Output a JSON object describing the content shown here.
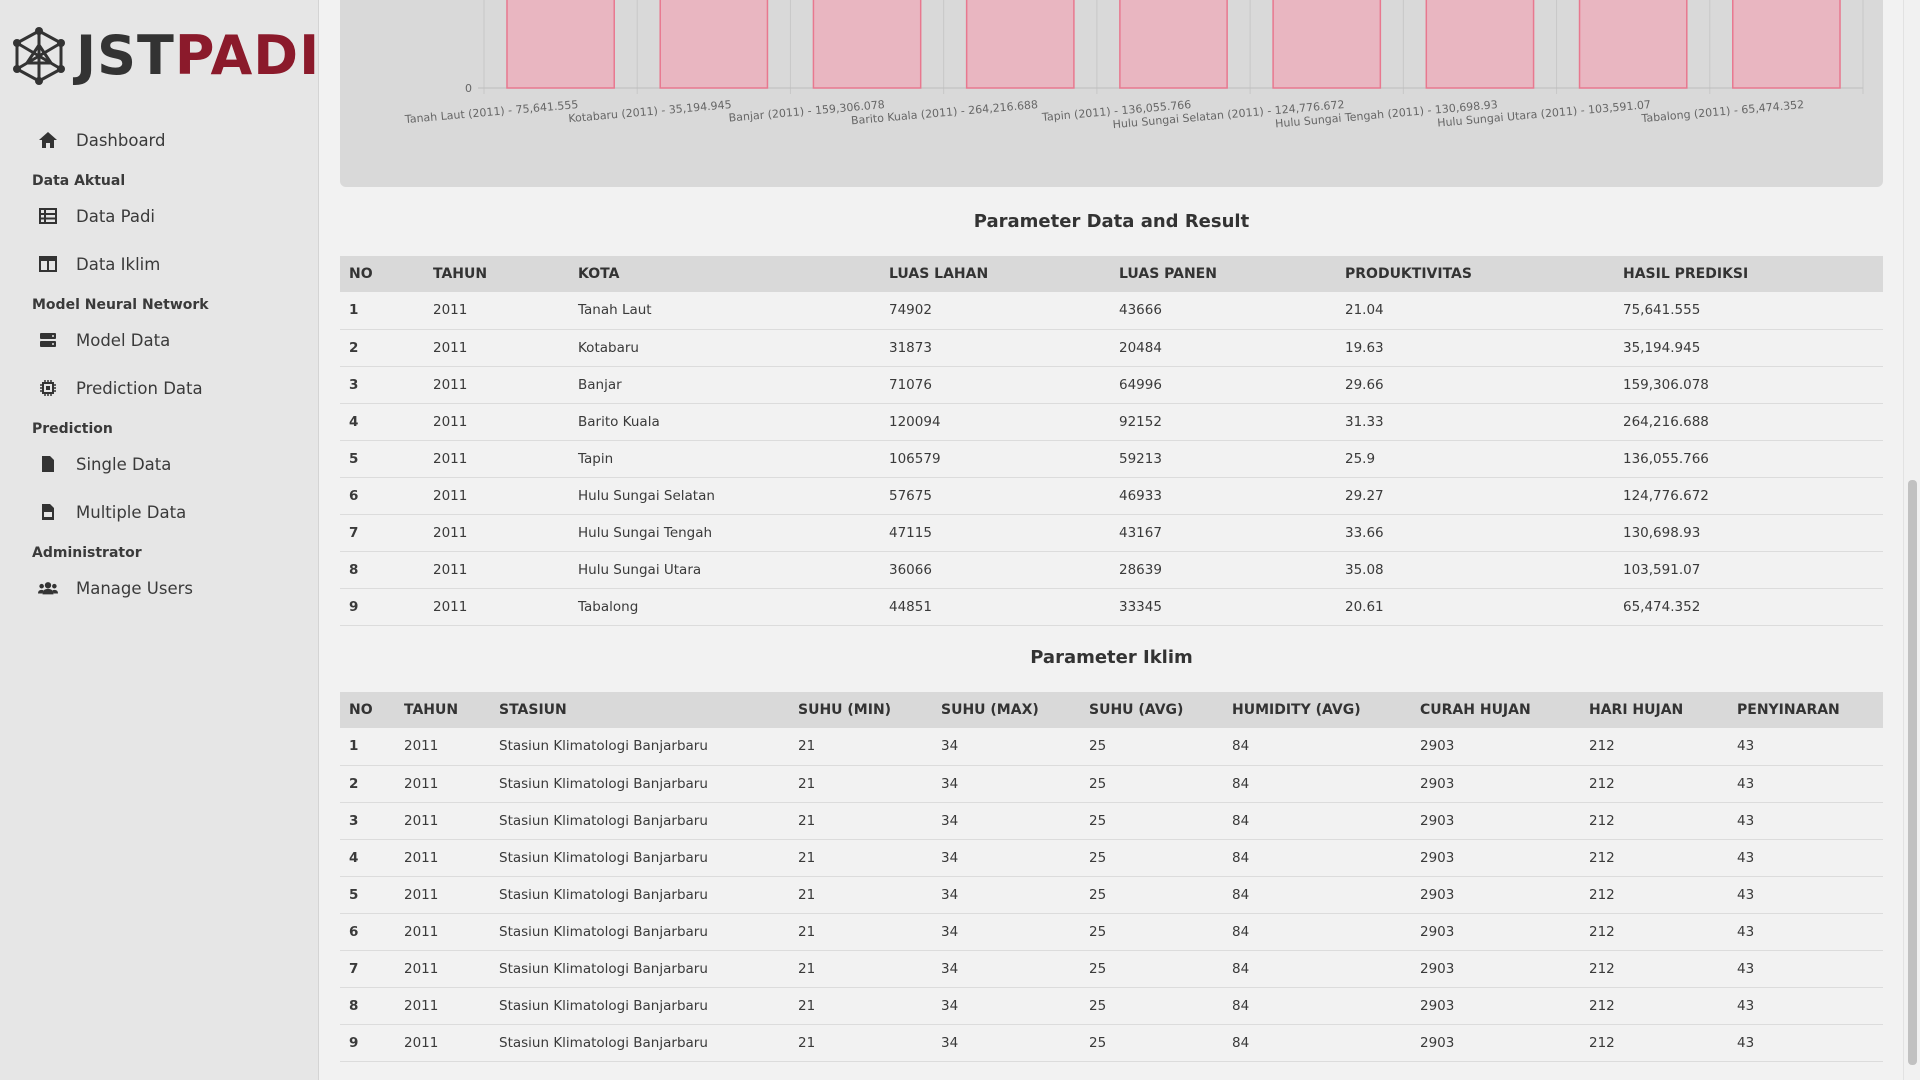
{
  "brand": {
    "part1": "JST",
    "part2": "PADI",
    "accent": "#8b1a2b"
  },
  "sidebar": {
    "dashboard": "Dashboard",
    "sections": {
      "data_aktual": "Data Aktual",
      "model_nn": "Model Neural Network",
      "prediction": "Prediction",
      "administrator": "Administrator"
    },
    "items": {
      "data_padi": "Data Padi",
      "data_iklim": "Data Iklim",
      "model_data": "Model Data",
      "prediction_data": "Prediction Data",
      "single_data": "Single Data",
      "multiple_data": "Multiple Data",
      "manage_users": "Manage Users"
    },
    "icons": {
      "dashboard": "home-icon",
      "data_padi": "table-list-icon",
      "data_iklim": "columns-icon",
      "model_data": "server-icon",
      "prediction_data": "microchip-icon",
      "single_data": "file-icon",
      "multiple_data": "file-csv-icon",
      "manage_users": "users-icon"
    }
  },
  "chart_data": {
    "type": "bar",
    "categories": [
      "Tanah Laut (2011) - 75,641.555",
      "Kotabaru (2011) - 35,194.945",
      "Banjar (2011) - 159,306.078",
      "Barito Kuala (2011) - 264,216.688",
      "Tapin (2011) - 136,055.766",
      "Hulu Sungai Selatan (2011) - 124,776.672",
      "Hulu Sungai Tengah (2011) - 130,698.93",
      "Hulu Sungai Utara (2011) - 103,591.07",
      "Tabalong (2011) - 65,474.352"
    ],
    "values": [
      75641.555,
      35194.945,
      159306.078,
      264216.688,
      136055.766,
      124776.672,
      130698.93,
      103591.07,
      65474.352
    ],
    "y_ticks_visible": [
      "0"
    ],
    "ylim_visible": [
      0,
      30000
    ],
    "bar_fill": "#e9b6c1",
    "bar_stroke": "#e8788f",
    "grid": true
  },
  "result_section": {
    "title": "Parameter Data and Result",
    "headers": [
      "NO",
      "TAHUN",
      "KOTA",
      "LUAS LAHAN",
      "LUAS PANEN",
      "PRODUKTIVITAS",
      "HASIL PREDIKSI"
    ],
    "rows": [
      [
        "1",
        "2011",
        "Tanah Laut",
        "74902",
        "43666",
        "21.04",
        "75,641.555"
      ],
      [
        "2",
        "2011",
        "Kotabaru",
        "31873",
        "20484",
        "19.63",
        "35,194.945"
      ],
      [
        "3",
        "2011",
        "Banjar",
        "71076",
        "64996",
        "29.66",
        "159,306.078"
      ],
      [
        "4",
        "2011",
        "Barito Kuala",
        "120094",
        "92152",
        "31.33",
        "264,216.688"
      ],
      [
        "5",
        "2011",
        "Tapin",
        "106579",
        "59213",
        "25.9",
        "136,055.766"
      ],
      [
        "6",
        "2011",
        "Hulu Sungai Selatan",
        "57675",
        "46933",
        "29.27",
        "124,776.672"
      ],
      [
        "7",
        "2011",
        "Hulu Sungai Tengah",
        "47115",
        "43167",
        "33.66",
        "130,698.93"
      ],
      [
        "8",
        "2011",
        "Hulu Sungai Utara",
        "36066",
        "28639",
        "35.08",
        "103,591.07"
      ],
      [
        "9",
        "2011",
        "Tabalong",
        "44851",
        "33345",
        "20.61",
        "65,474.352"
      ]
    ]
  },
  "iklim_section": {
    "title": "Parameter Iklim",
    "headers": [
      "NO",
      "TAHUN",
      "STASIUN",
      "SUHU (MIN)",
      "SUHU (MAX)",
      "SUHU (AVG)",
      "HUMIDITY (AVG)",
      "CURAH HUJAN",
      "HARI HUJAN",
      "PENYINARAN"
    ],
    "rows": [
      [
        "1",
        "2011",
        "Stasiun Klimatologi Banjarbaru",
        "21",
        "34",
        "25",
        "84",
        "2903",
        "212",
        "43"
      ],
      [
        "2",
        "2011",
        "Stasiun Klimatologi Banjarbaru",
        "21",
        "34",
        "25",
        "84",
        "2903",
        "212",
        "43"
      ],
      [
        "3",
        "2011",
        "Stasiun Klimatologi Banjarbaru",
        "21",
        "34",
        "25",
        "84",
        "2903",
        "212",
        "43"
      ],
      [
        "4",
        "2011",
        "Stasiun Klimatologi Banjarbaru",
        "21",
        "34",
        "25",
        "84",
        "2903",
        "212",
        "43"
      ],
      [
        "5",
        "2011",
        "Stasiun Klimatologi Banjarbaru",
        "21",
        "34",
        "25",
        "84",
        "2903",
        "212",
        "43"
      ],
      [
        "6",
        "2011",
        "Stasiun Klimatologi Banjarbaru",
        "21",
        "34",
        "25",
        "84",
        "2903",
        "212",
        "43"
      ],
      [
        "7",
        "2011",
        "Stasiun Klimatologi Banjarbaru",
        "21",
        "34",
        "25",
        "84",
        "2903",
        "212",
        "43"
      ],
      [
        "8",
        "2011",
        "Stasiun Klimatologi Banjarbaru",
        "21",
        "34",
        "25",
        "84",
        "2903",
        "212",
        "43"
      ],
      [
        "9",
        "2011",
        "Stasiun Klimatologi Banjarbaru",
        "21",
        "34",
        "25",
        "84",
        "2903",
        "212",
        "43"
      ]
    ]
  }
}
